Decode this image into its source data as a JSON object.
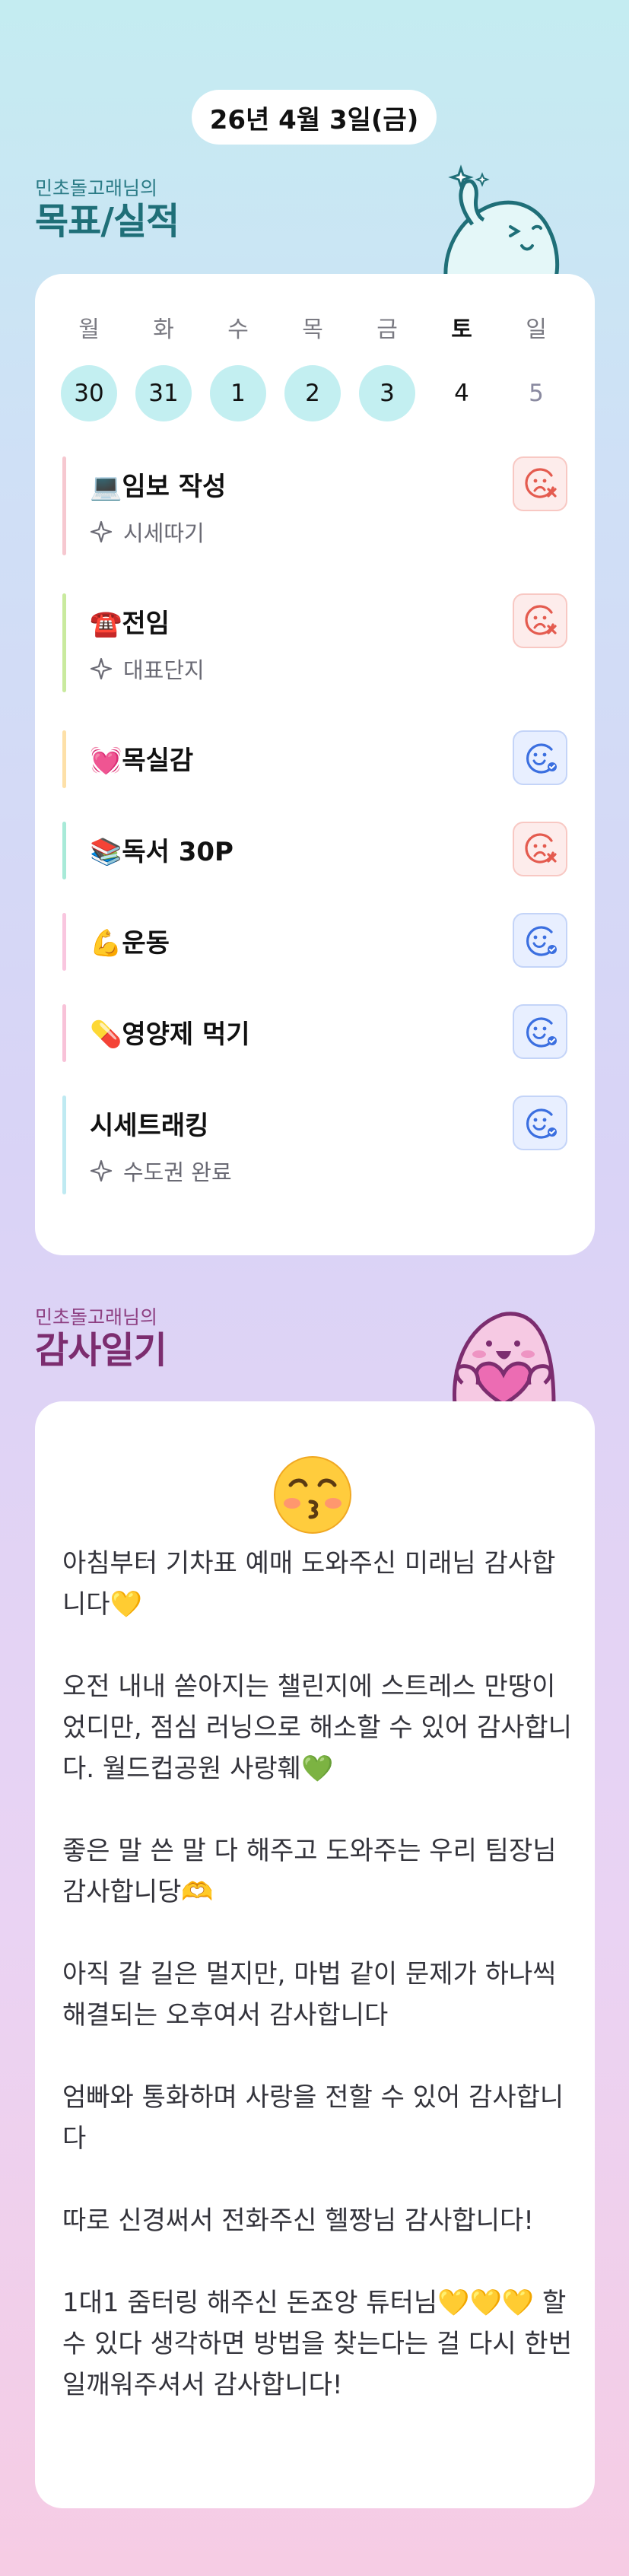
{
  "date_label": "26년 4월 3일(금)",
  "goals_section": {
    "small": "민초돌고래님의",
    "big": "목표/실적"
  },
  "week": [
    {
      "dow": "월",
      "day": "30",
      "state": "done"
    },
    {
      "dow": "화",
      "day": "31",
      "state": "done"
    },
    {
      "dow": "수",
      "day": "1",
      "state": "done"
    },
    {
      "dow": "목",
      "day": "2",
      "state": "done"
    },
    {
      "dow": "금",
      "day": "3",
      "state": "done"
    },
    {
      "dow": "토",
      "day": "4",
      "state": "today"
    },
    {
      "dow": "일",
      "day": "5",
      "state": "future"
    }
  ],
  "goals": [
    {
      "title": "💻임보 작성",
      "sub": "시세따기",
      "bar_color": "#f6c8d0",
      "status": "fail"
    },
    {
      "title": "☎️전임",
      "sub": "대표단지",
      "bar_color": "#c9ea9e",
      "status": "fail"
    },
    {
      "title": "💓목실감",
      "sub": "",
      "bar_color": "#fde0a8",
      "status": "pass"
    },
    {
      "title": "📚독서 30P",
      "sub": "",
      "bar_color": "#a8ead8",
      "status": "fail"
    },
    {
      "title": "💪운동",
      "sub": "",
      "bar_color": "#f9c6df",
      "status": "pass"
    },
    {
      "title": "💊영양제 먹기",
      "sub": "",
      "bar_color": "#f8c2d8",
      "status": "pass"
    },
    {
      "title": "시세트래킹",
      "sub": "수도권 완료",
      "bar_color": "#bfeaf2",
      "status": "pass"
    }
  ],
  "thanks_section": {
    "small": "민초돌고래님의",
    "big": "감사일기"
  },
  "thanks_emoji": "😚",
  "thanks_entries": [
    "아침부터 기차표 예매 도와주신 미래님 감사합니다💛",
    "오전 내내 쏟아지는 챌린지에 스트레스 만땅이었디만, 점심 러닝으로 해소할 수 있어 감사합니다. 월드컵공원 사랑훼💚",
    "좋은 말 쓴 말 다 해주고 도와주는 우리 팀장님 감사합니당🫶",
    "아직 갈 길은 멀지만, 마법 같이 문제가 하나씩 해결되는 오후여서 감사합니다",
    "엄빠와 통화하며 사랑을 전할 수 있어 감사합니다",
    "따로 신경써서 전화주신 헬짱님 감사합니다!",
    "1대1 줌터링 해주신 돈죠앙 튜터님💛💛💛 할 수 있다 생각하면 방법을 찾는다는 걸 다시 한번 일깨워주셔서 감사합니다!"
  ],
  "colors": {
    "fail_icon": "#e45b4f",
    "pass_icon": "#3b6fe0",
    "done_day_bg": "#c3eff1"
  },
  "icons": {
    "status_fail": "sad-face-x-icon",
    "status_pass": "smile-face-check-icon",
    "sub_marker": "sparkle-icon"
  }
}
